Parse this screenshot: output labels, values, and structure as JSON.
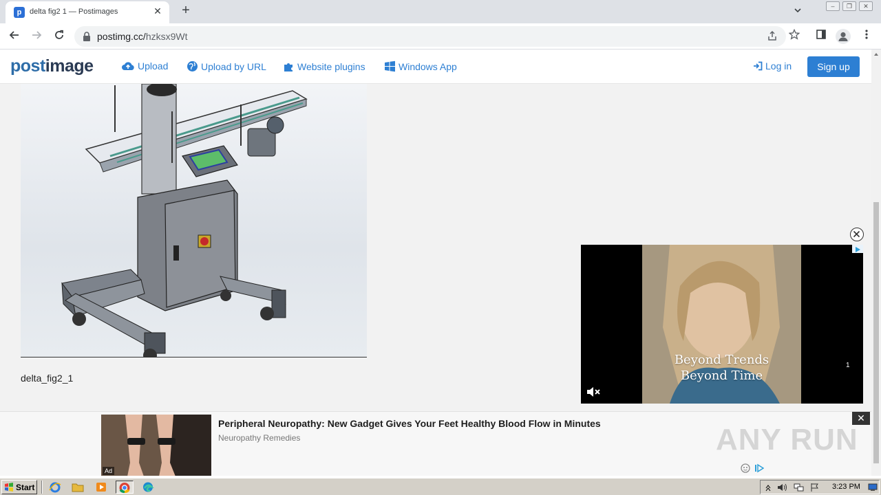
{
  "browser": {
    "tab_title": "delta fig2 1 — Postimages",
    "tab_close": "✕",
    "new_tab": "+",
    "url_host": "postimg.cc/",
    "url_path": "hzksx9Wt"
  },
  "site": {
    "logo_post": "post",
    "logo_image": "image",
    "nav": {
      "upload": "Upload",
      "upload_by_url": "Upload by URL",
      "website_plugins": "Website plugins",
      "windows_app": "Windows App",
      "login": "Log in",
      "signup": "Sign up"
    },
    "caption": "delta_fig2_1",
    "accent_color": "#2d7fd3"
  },
  "video_ad": {
    "line1": "Beyond Trends",
    "line2": "Beyond Time",
    "counter": "1"
  },
  "bottom_ad": {
    "headline": "Peripheral Neuropathy: New Gadget Gives Your Feet Healthy Blood Flow in Minutes",
    "source": "Neuropathy Remedies",
    "badge": "Ad",
    "close": "✕",
    "watermark": "ANY RUN"
  },
  "taskbar": {
    "start": "Start",
    "clock": "3:23 PM"
  }
}
